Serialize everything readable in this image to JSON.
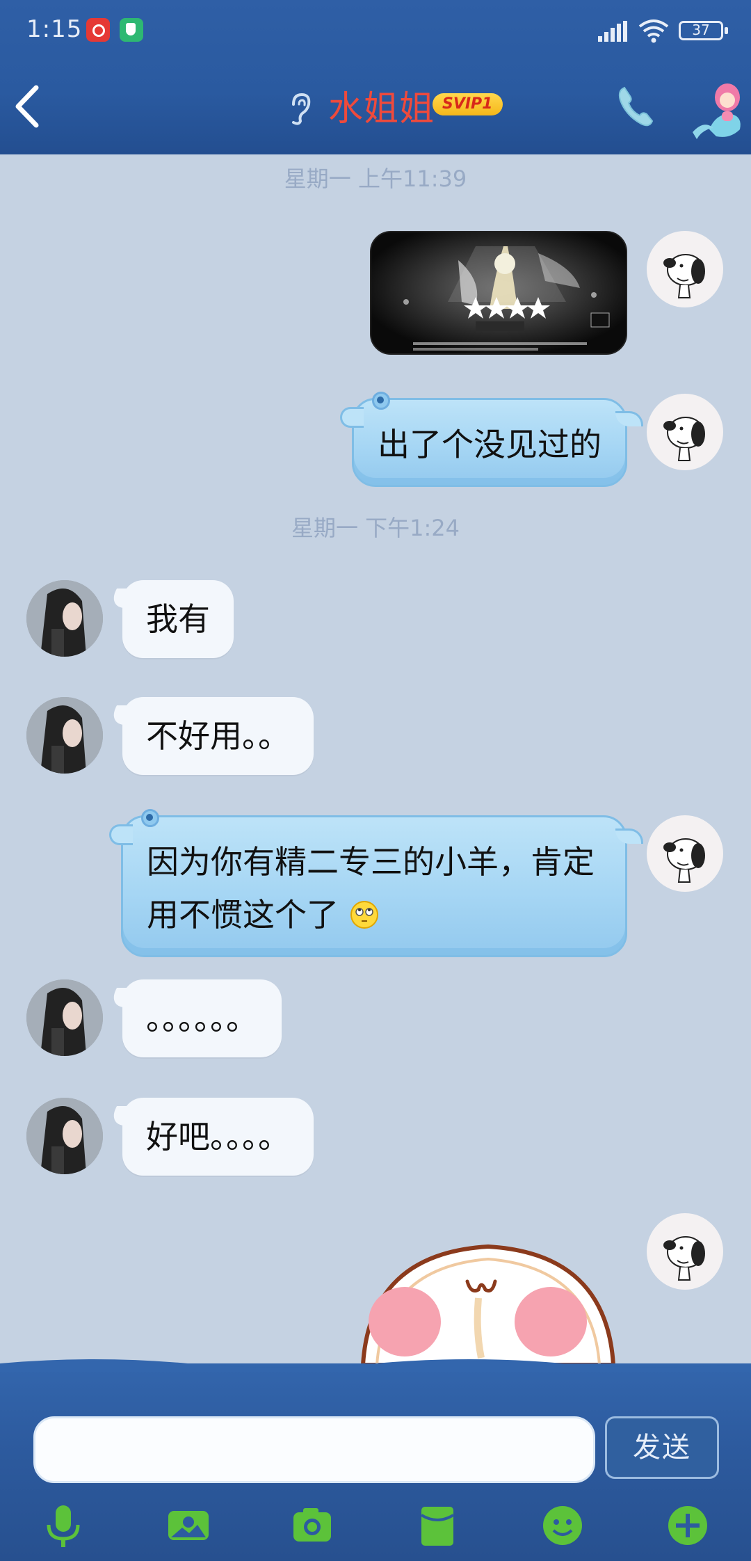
{
  "status_bar": {
    "time": "1:15",
    "battery": "37"
  },
  "header": {
    "contact_name": "水姐姐",
    "badge": "SVIP1"
  },
  "chat": {
    "timestamps": [
      "星期一 上午11:39",
      "星期一 下午1:24"
    ],
    "messages": [
      {
        "side": "right",
        "type": "image",
        "caption": ""
      },
      {
        "side": "right",
        "type": "text",
        "text": "出了个没见过的"
      },
      {
        "side": "left",
        "type": "text",
        "text": "我有"
      },
      {
        "side": "left",
        "type": "text",
        "text": "不好用。。"
      },
      {
        "side": "right",
        "type": "text",
        "text": "因为你有精二专三的小羊，肯定用不惯这个了"
      },
      {
        "side": "left",
        "type": "text",
        "text": "。。。。。。"
      },
      {
        "side": "left",
        "type": "text",
        "text": "好吧。。。。"
      },
      {
        "side": "right",
        "type": "sticker",
        "caption": ""
      }
    ]
  },
  "input": {
    "value": "",
    "placeholder": "",
    "send_label": "发送"
  },
  "toolbar": {
    "icons": [
      "microphone-icon",
      "photo-icon",
      "camera-icon",
      "red-packet-icon",
      "emoji-icon",
      "plus-icon"
    ]
  },
  "colors": {
    "header_bg": "#2a5aa0",
    "chat_bg": "#c5d2e2",
    "bubble_right": "#a6d6f4",
    "bubble_left": "#f3f7fc",
    "name_color": "#ef4a3c",
    "toolbar_icon": "#5cc23a"
  }
}
